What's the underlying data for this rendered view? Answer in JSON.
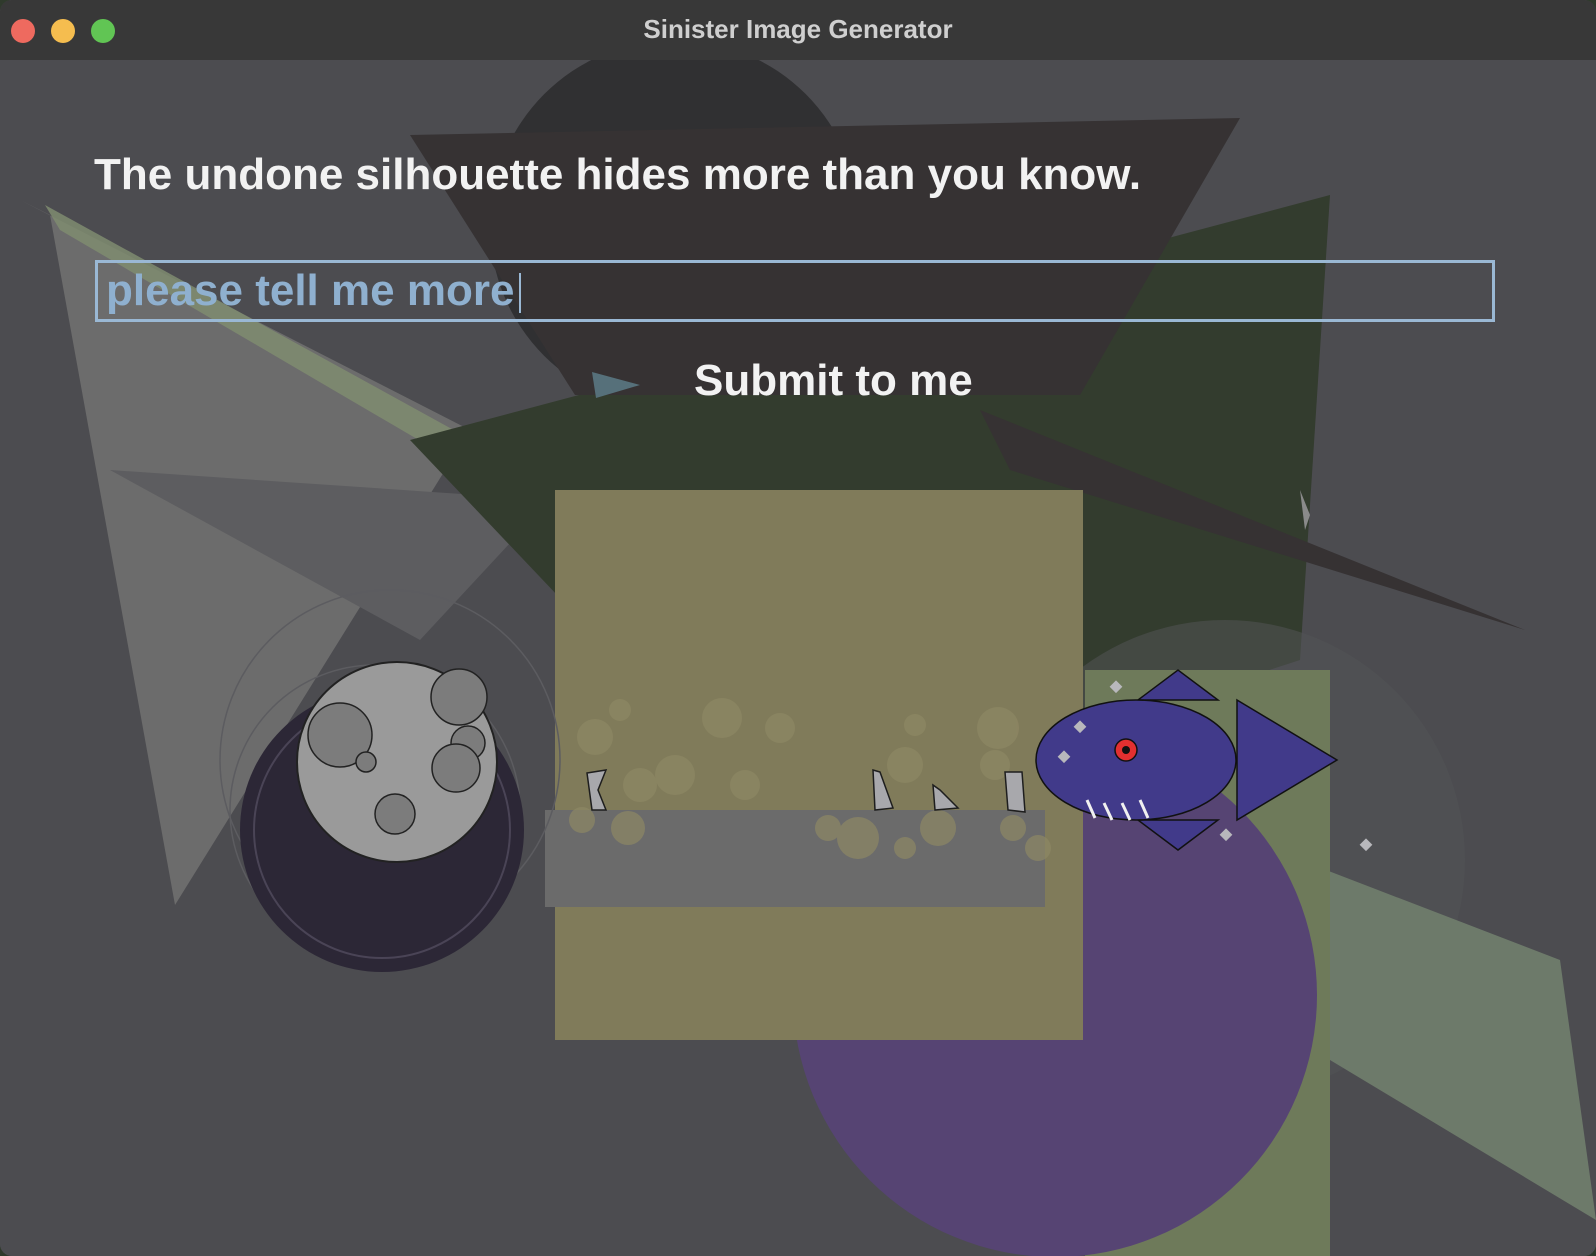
{
  "window": {
    "title": "Sinister Image Generator"
  },
  "main": {
    "headline": "The undone silhouette hides more than you know.",
    "input": {
      "value": "please tell me more",
      "placeholder": ""
    },
    "submit_label": "Submit to me"
  },
  "colors": {
    "background": "#4c4c50",
    "headline_text": "#f2f2f2",
    "input_border": "#9ab8d4",
    "input_text": "#8fb0cf",
    "olive_rect": "#807b5a",
    "purple_circle": "#564473",
    "fish_body": "#413a8a",
    "fish_eye": "#e33030"
  }
}
